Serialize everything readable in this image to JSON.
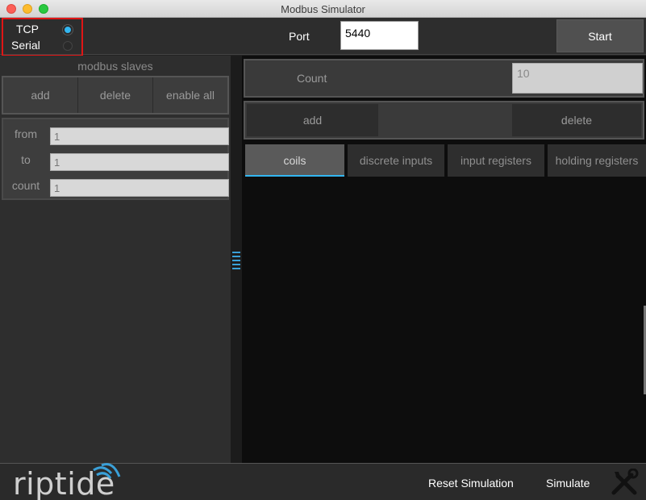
{
  "window": {
    "title": "Modbus Simulator"
  },
  "mode": {
    "tcp_label": "TCP",
    "serial_label": "Serial",
    "selected": "TCP"
  },
  "port": {
    "label": "Port",
    "value": "5440"
  },
  "start_label": "Start",
  "slaves": {
    "title": "modbus slaves",
    "buttons": [
      "add",
      "delete",
      "enable all"
    ],
    "from_label": "from",
    "from_value": "1",
    "to_label": "to",
    "to_value": "1",
    "count_label": "count",
    "count_value": "1"
  },
  "registers": {
    "count_label": "Count",
    "count_value": "10",
    "add_label": "add",
    "delete_label": "delete",
    "tabs": [
      "coils",
      "discrete inputs",
      "input registers",
      "holding registers"
    ],
    "active_tab": "coils"
  },
  "footer": {
    "logo_text": "riptide",
    "reset_label": "Reset Simulation",
    "simulate_label": "Simulate"
  },
  "colors": {
    "accent": "#33b6f0",
    "highlight_border": "#e01515"
  },
  "icons": [
    "tools-icon",
    "riptide-logo"
  ]
}
